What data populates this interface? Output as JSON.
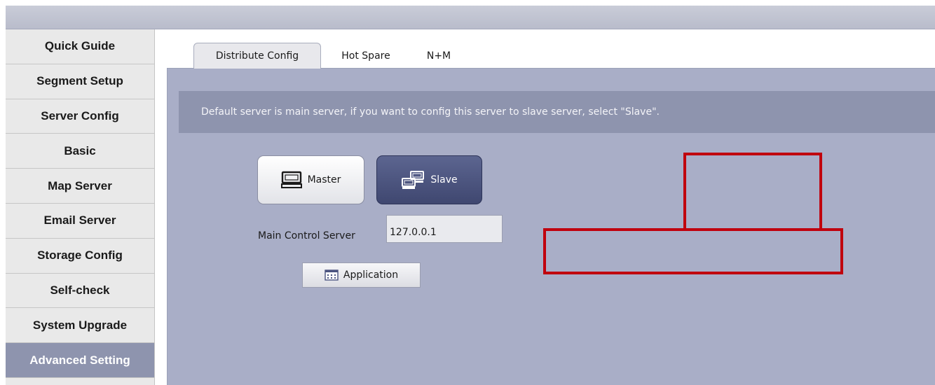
{
  "sidebar": {
    "items": [
      {
        "label": "Quick Guide"
      },
      {
        "label": "Segment Setup"
      },
      {
        "label": "Server Config"
      },
      {
        "label": "Basic"
      },
      {
        "label": "Map Server"
      },
      {
        "label": "Email Server"
      },
      {
        "label": "Storage Config"
      },
      {
        "label": "Self-check"
      },
      {
        "label": "System Upgrade"
      },
      {
        "label": "Advanced Setting",
        "active": true
      }
    ]
  },
  "tabs": [
    {
      "label": "Distribute Config",
      "active": true
    },
    {
      "label": "Hot Spare"
    },
    {
      "label": "N+M"
    }
  ],
  "notice": "Default server is main server, if you want to config this server to slave server, select \"Slave\".",
  "mode": {
    "master_label": "Master",
    "slave_label": "Slave",
    "selected": "Slave"
  },
  "main_control_server": {
    "label": "Main Control Server",
    "value": "127.0.0.1"
  },
  "application_button": "Application",
  "icons": {
    "master": "monitor-icon",
    "slave": "network-servers-icon",
    "application": "keyboard-icon"
  },
  "colors": {
    "accent": "#8e94ae",
    "selected_button": "#4b5480",
    "content_bg": "#a9aec7",
    "highlight_box": "#c0000d"
  }
}
